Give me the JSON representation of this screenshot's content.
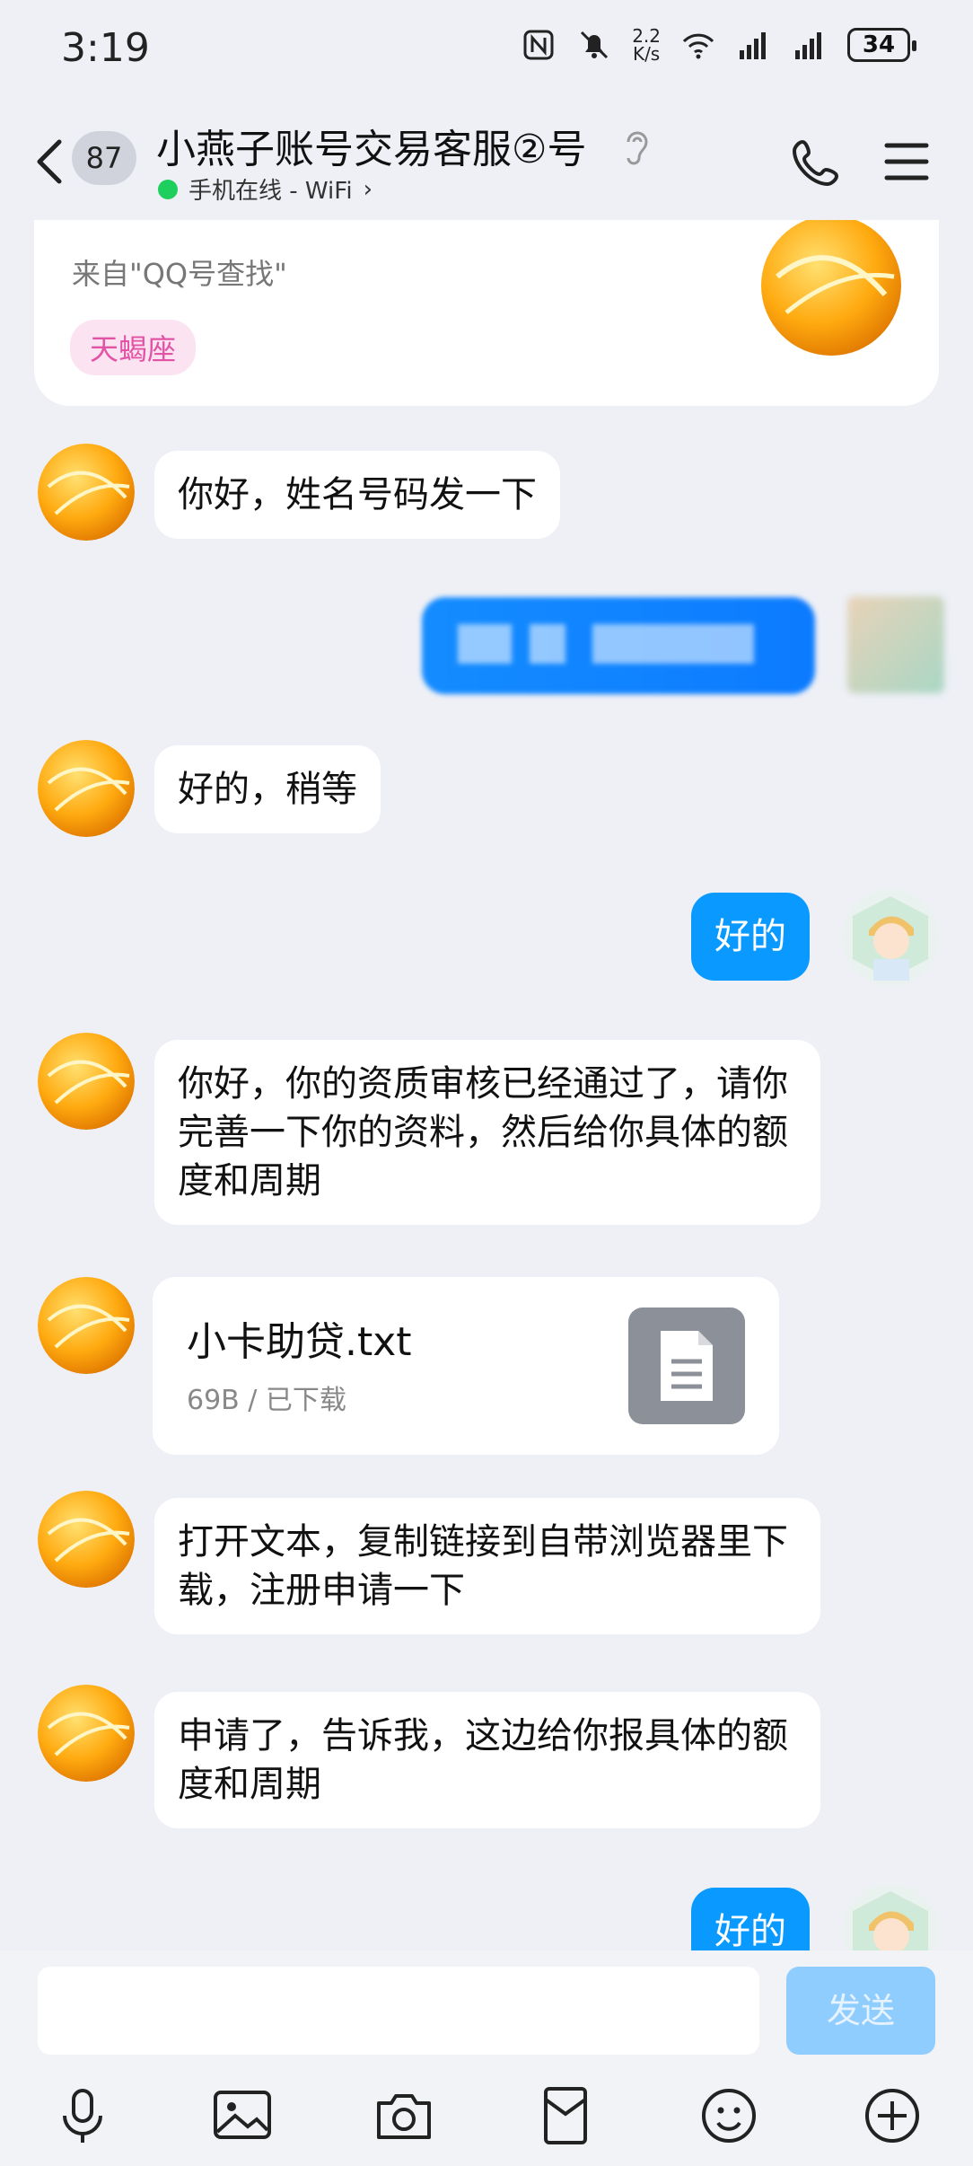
{
  "status_bar": {
    "time": "3:19",
    "net_speed_value": "2.2",
    "net_speed_unit": "K/s",
    "battery": "34",
    "icons": [
      "nfc-icon",
      "bell-off-icon",
      "wifi-icon",
      "signal-icon",
      "signal-icon"
    ]
  },
  "header": {
    "unread_count": "87",
    "title": "小燕子账号交易客服②号",
    "online_status": "手机在线 - WiFi",
    "online_chevron": "›",
    "icons": [
      "back-chevron-icon",
      "ear-icon",
      "phone-icon",
      "menu-icon"
    ]
  },
  "profile_card": {
    "source": "来自\"QQ号查找\"",
    "tag": "天蝎座"
  },
  "messages": [
    {
      "from": "other",
      "text": "你好，姓名号码发一下"
    },
    {
      "from": "me",
      "text": ""
    },
    {
      "from": "other",
      "text": "好的，稍等"
    },
    {
      "from": "me",
      "text": "好的"
    },
    {
      "from": "other",
      "text": "你好，你的资质审核已经通过了，请你完善一下你的资料，然后给你具体的额度和周期"
    },
    {
      "from": "other",
      "type": "file",
      "file_name": "小卡助贷.txt",
      "file_meta": "69B / 已下载"
    },
    {
      "from": "other",
      "text": "打开文本，复制链接到自带浏览器里下载，注册申请一下"
    },
    {
      "from": "other",
      "text": "申请了，告诉我，这边给你报具体的额度和周期"
    },
    {
      "from": "me",
      "text": "好的"
    }
  ],
  "input_bar": {
    "placeholder": "",
    "send_label": "发送",
    "toolbar_icons": [
      "microphone-icon",
      "image-icon",
      "camera-icon",
      "red-packet-icon",
      "emoji-icon",
      "plus-icon"
    ]
  },
  "colors": {
    "background": "#eef0f6",
    "my_bubble": "#0a9aff",
    "online_dot": "#1fcf5e",
    "send_disabled": "#8fcdff"
  }
}
